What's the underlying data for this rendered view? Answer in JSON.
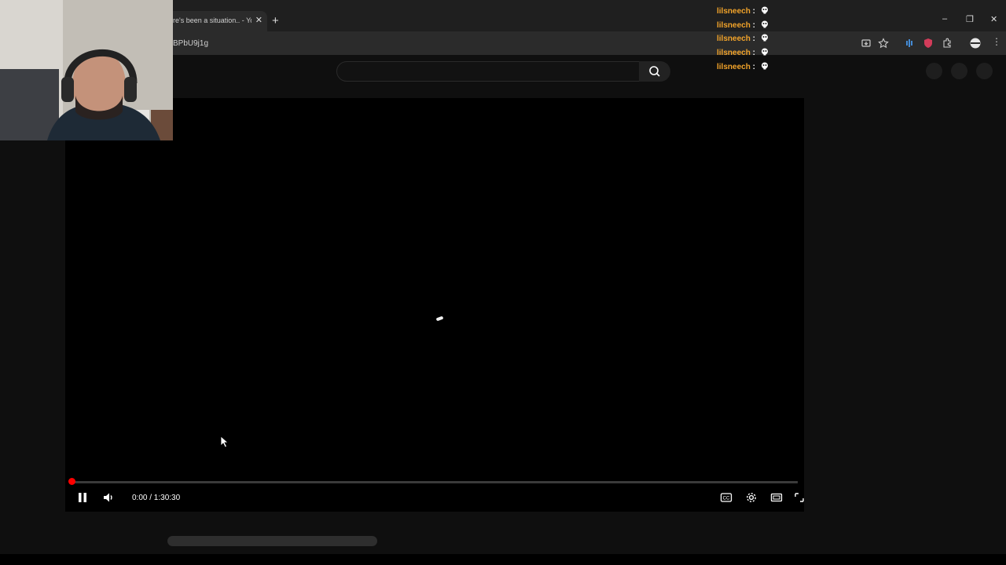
{
  "browser": {
    "tab_title": "re's been a situation.. - YouT",
    "new_tab_label": "+",
    "tab_close": "✕",
    "url_fragment": "BPbU9j1g",
    "window_controls": {
      "minimize": "–",
      "restore": "❐",
      "close": "✕"
    },
    "menu": "⋮"
  },
  "player": {
    "current_time": "0:00",
    "duration": "1:30:30",
    "time_display": "0:00 / 1:30:30",
    "progress_fraction": 0.0,
    "state": "loading"
  },
  "chat": {
    "messages": [
      {
        "user": "lilsneech",
        "separator": ":",
        "emote": "skull-emote"
      },
      {
        "user": "lilsneech",
        "separator": ":",
        "emote": "skull-emote"
      },
      {
        "user": "lilsneech",
        "separator": ":",
        "emote": "skull-emote"
      },
      {
        "user": "lilsneech",
        "separator": ":",
        "emote": "skull-emote"
      },
      {
        "user": "lilsneech",
        "separator": ":",
        "emote": "skull-emote"
      }
    ]
  },
  "colors": {
    "chat_username": "#f3a42a",
    "progress": "#ff0000",
    "page_bg": "#0f0f0f"
  }
}
